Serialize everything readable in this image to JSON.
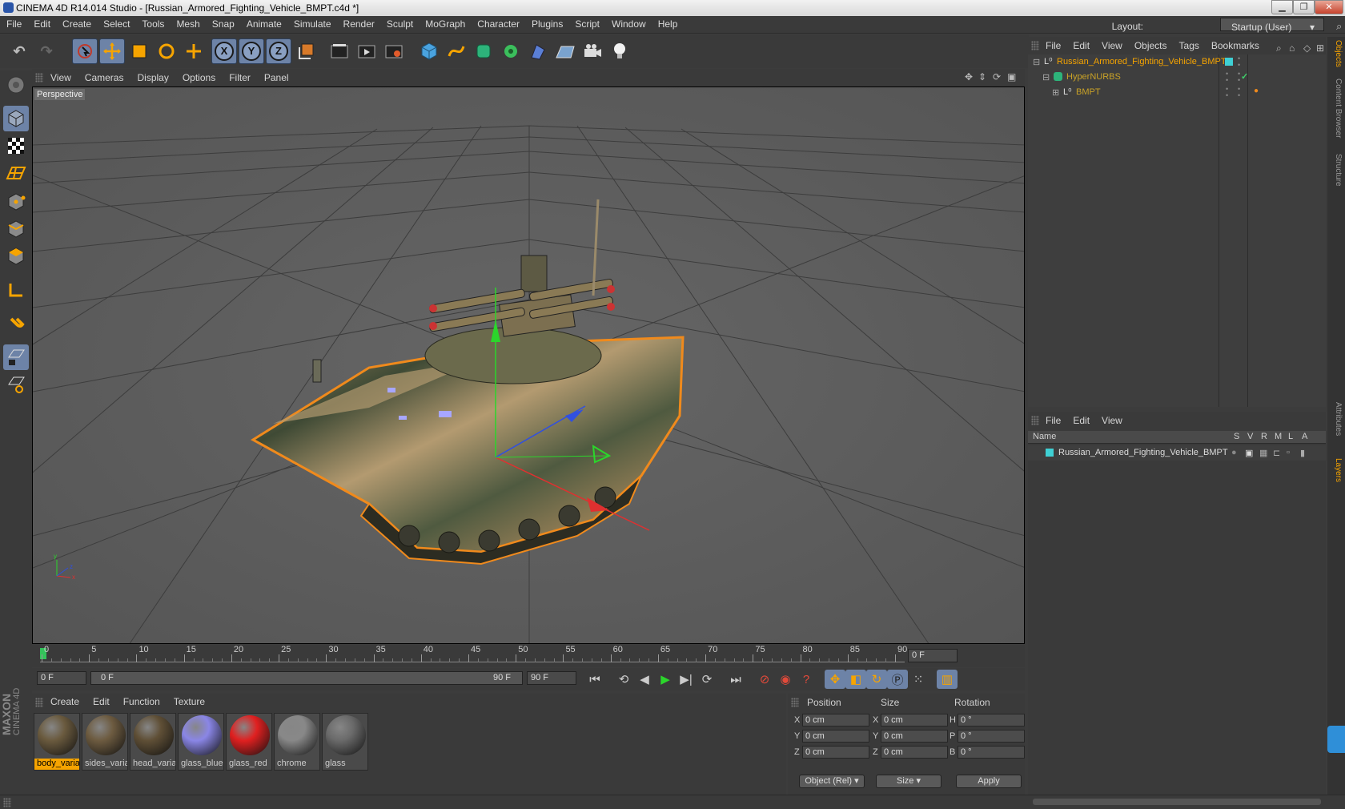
{
  "window": {
    "title": "CINEMA 4D R14.014 Studio - [Russian_Armored_Fighting_Vehicle_BMPT.c4d *]"
  },
  "menubar": {
    "items": [
      "File",
      "Edit",
      "Create",
      "Select",
      "Tools",
      "Mesh",
      "Snap",
      "Animate",
      "Simulate",
      "Render",
      "Sculpt",
      "MoGraph",
      "Character",
      "Plugins",
      "Script",
      "Window",
      "Help"
    ],
    "layout_label": "Layout:",
    "layout_value": "Startup (User)"
  },
  "viewport": {
    "menu": [
      "View",
      "Cameras",
      "Display",
      "Options",
      "Filter",
      "Panel"
    ],
    "label": "Perspective"
  },
  "timeline": {
    "ticks": [
      "0",
      "5",
      "10",
      "15",
      "20",
      "25",
      "30",
      "35",
      "40",
      "45",
      "50",
      "55",
      "60",
      "65",
      "70",
      "75",
      "80",
      "85",
      "90"
    ],
    "current_frame": "0 F",
    "start_field": "0 F",
    "slider_left": "0 F",
    "slider_right": "90 F",
    "end_field": "90 F"
  },
  "material_manager": {
    "menu": [
      "Create",
      "Edit",
      "Function",
      "Texture"
    ],
    "materials": [
      {
        "name": "body_varia",
        "color": "#6a5a3e",
        "selected": true
      },
      {
        "name": "sides_varia",
        "color": "#6d5b40",
        "selected": false
      },
      {
        "name": "head_varia",
        "color": "#5f4f36",
        "selected": false
      },
      {
        "name": "glass_blue",
        "color": "#8a86e6",
        "selected": false
      },
      {
        "name": "glass_red",
        "color": "#e02020",
        "selected": false
      },
      {
        "name": "chrome",
        "color": "#888888",
        "selected": false
      },
      {
        "name": "glass",
        "color": "#6a6a6a",
        "selected": false
      }
    ]
  },
  "coordinates": {
    "headers": {
      "position": "Position",
      "size": "Size",
      "rotation": "Rotation"
    },
    "rows": [
      {
        "axis": "X",
        "pos": "0 cm",
        "size_axis": "X",
        "size": "0 cm",
        "rot_axis": "H",
        "rot": "0 °"
      },
      {
        "axis": "Y",
        "pos": "0 cm",
        "size_axis": "Y",
        "size": "0 cm",
        "rot_axis": "P",
        "rot": "0 °"
      },
      {
        "axis": "Z",
        "pos": "0 cm",
        "size_axis": "Z",
        "size": "0 cm",
        "rot_axis": "B",
        "rot": "0 °"
      }
    ],
    "mode_select": "Object (Rel)",
    "size_select": "Size",
    "apply": "Apply"
  },
  "object_manager": {
    "menu": [
      "File",
      "Edit",
      "View",
      "Objects",
      "Tags",
      "Bookmarks"
    ],
    "objects": [
      {
        "name": "Russian_Armored_Fighting_Vehicle_BMPT",
        "level": 0
      },
      {
        "name": "HyperNURBS",
        "level": 1
      },
      {
        "name": "BMPT",
        "level": 2
      }
    ]
  },
  "layer_manager": {
    "menu": [
      "File",
      "Edit",
      "View"
    ],
    "columns": {
      "name": "Name",
      "flags": [
        "S",
        "V",
        "R",
        "M",
        "L",
        "A"
      ]
    },
    "rows": [
      {
        "name": "Russian_Armored_Fighting_Vehicle_BMPT",
        "color": "#3fd0d4"
      }
    ]
  },
  "right_tabs": [
    "Objects",
    "Content Browser",
    "Structure",
    "Attributes",
    "Layers"
  ],
  "brand": {
    "line1": "MAXON",
    "line2": "CINEMA 4D"
  },
  "colors": {
    "accent": "#f6a400",
    "selection": "#6d83a7",
    "teal": "#3fd0d4"
  }
}
